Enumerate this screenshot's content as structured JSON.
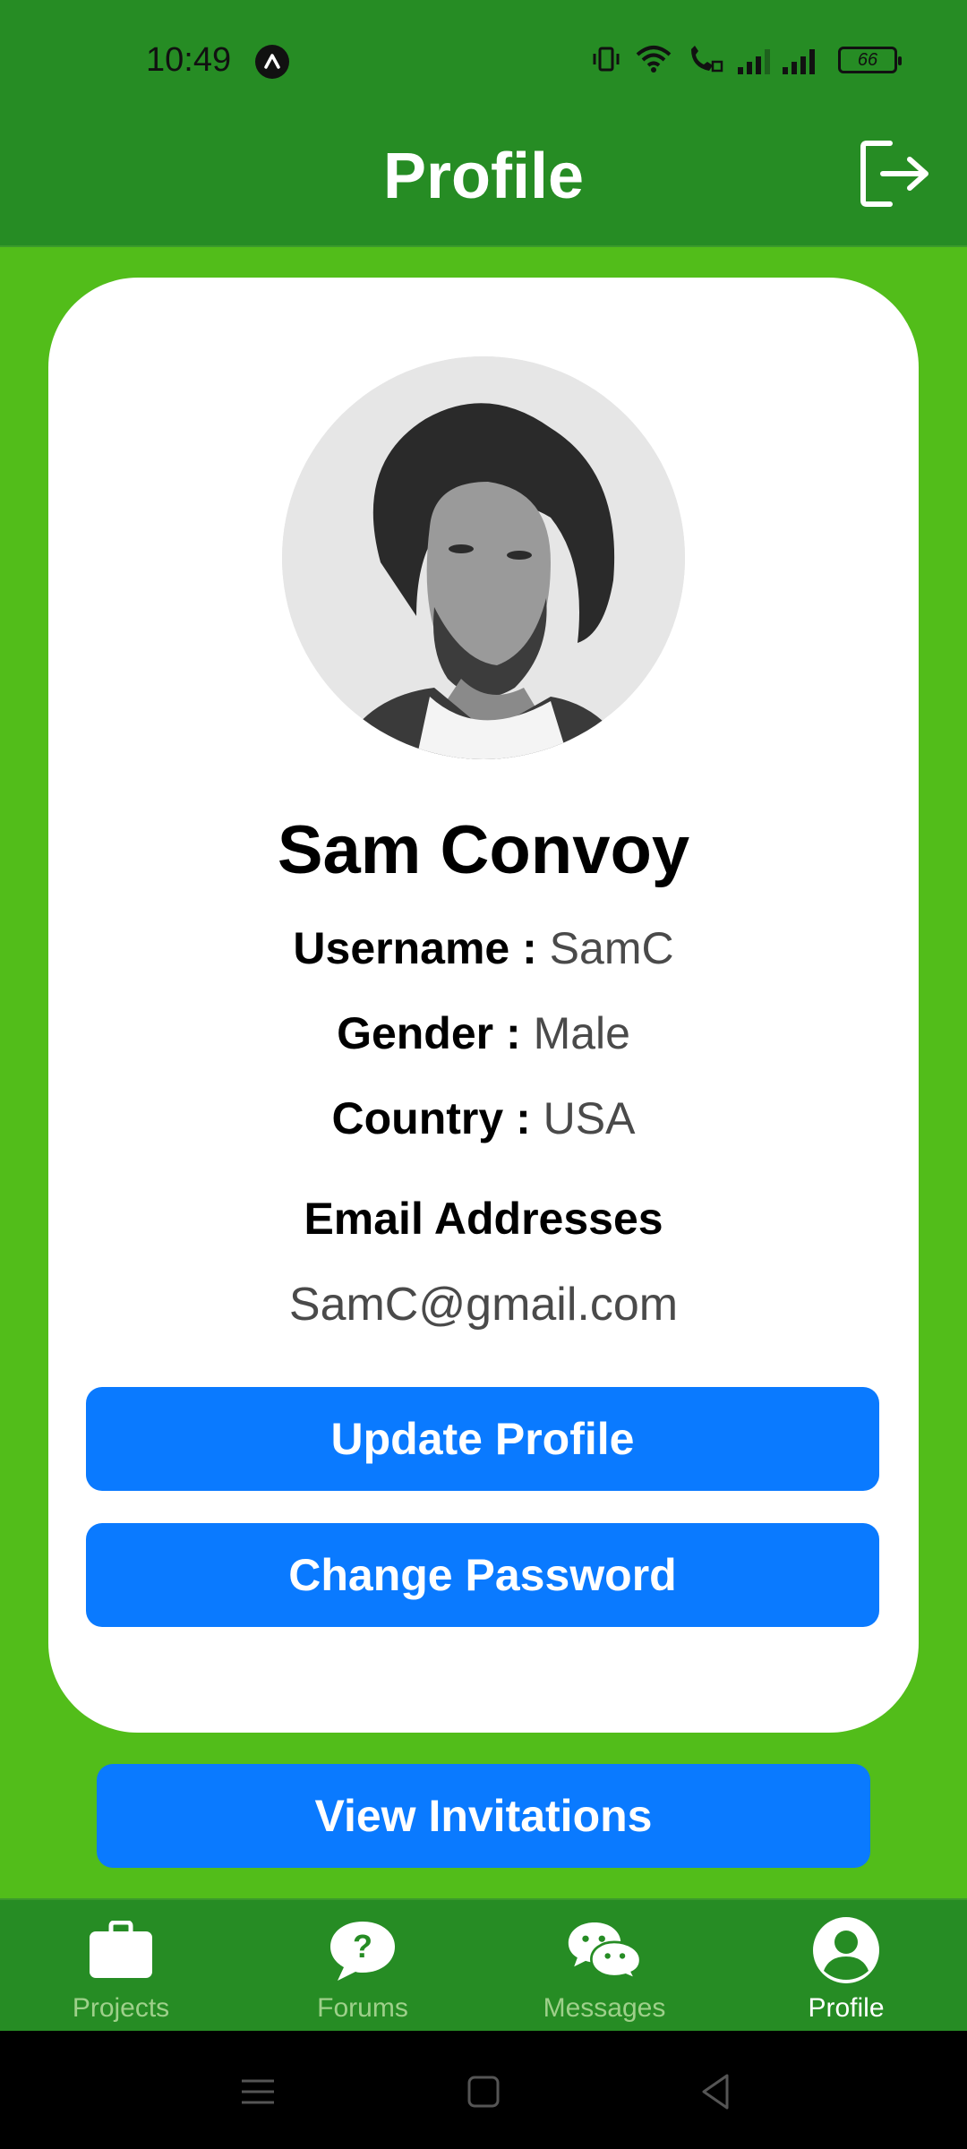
{
  "status_bar": {
    "time": "10:49",
    "battery": "66"
  },
  "header": {
    "title": "Profile"
  },
  "profile": {
    "full_name": "Sam Convoy",
    "username_label": "Username :",
    "username_value": "SamC",
    "gender_label": "Gender :",
    "gender_value": "Male",
    "country_label": "Country :",
    "country_value": "USA",
    "email_heading": "Email Addresses",
    "email_value": "SamC@gmail.com"
  },
  "buttons": {
    "update_profile": "Update Profile",
    "change_password": "Change Password",
    "view_invitations": "View Invitations"
  },
  "bottom_nav": {
    "items": [
      {
        "label": "Projects",
        "icon": "briefcase-icon",
        "active": false
      },
      {
        "label": "Forums",
        "icon": "question-bubble-icon",
        "active": false
      },
      {
        "label": "Messages",
        "icon": "chat-bubbles-icon",
        "active": false
      },
      {
        "label": "Profile",
        "icon": "user-circle-icon",
        "active": true
      }
    ]
  },
  "colors": {
    "header_green": "#268c24",
    "background_green": "#52bd1a",
    "button_blue": "#0a7aff",
    "inactive_nav_label": "#9ed08a"
  }
}
